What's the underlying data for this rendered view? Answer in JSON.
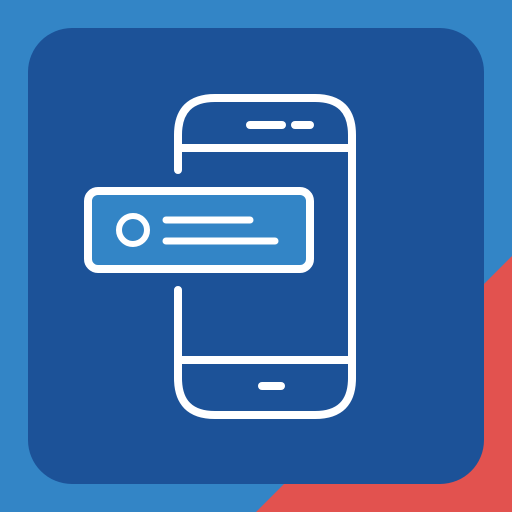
{
  "app_icon": {
    "name": "phone-notification-app-icon",
    "colors": {
      "background_blue": "#3385C6",
      "corner_red": "#E2524F",
      "tile_navy": "#1C5298",
      "line_white": "#FFFFFF",
      "notification_fill": "#3385C6"
    },
    "icons": {
      "phone": "smartphone-icon",
      "notification": "notification-banner-icon",
      "avatar": "avatar-circle-icon"
    }
  }
}
